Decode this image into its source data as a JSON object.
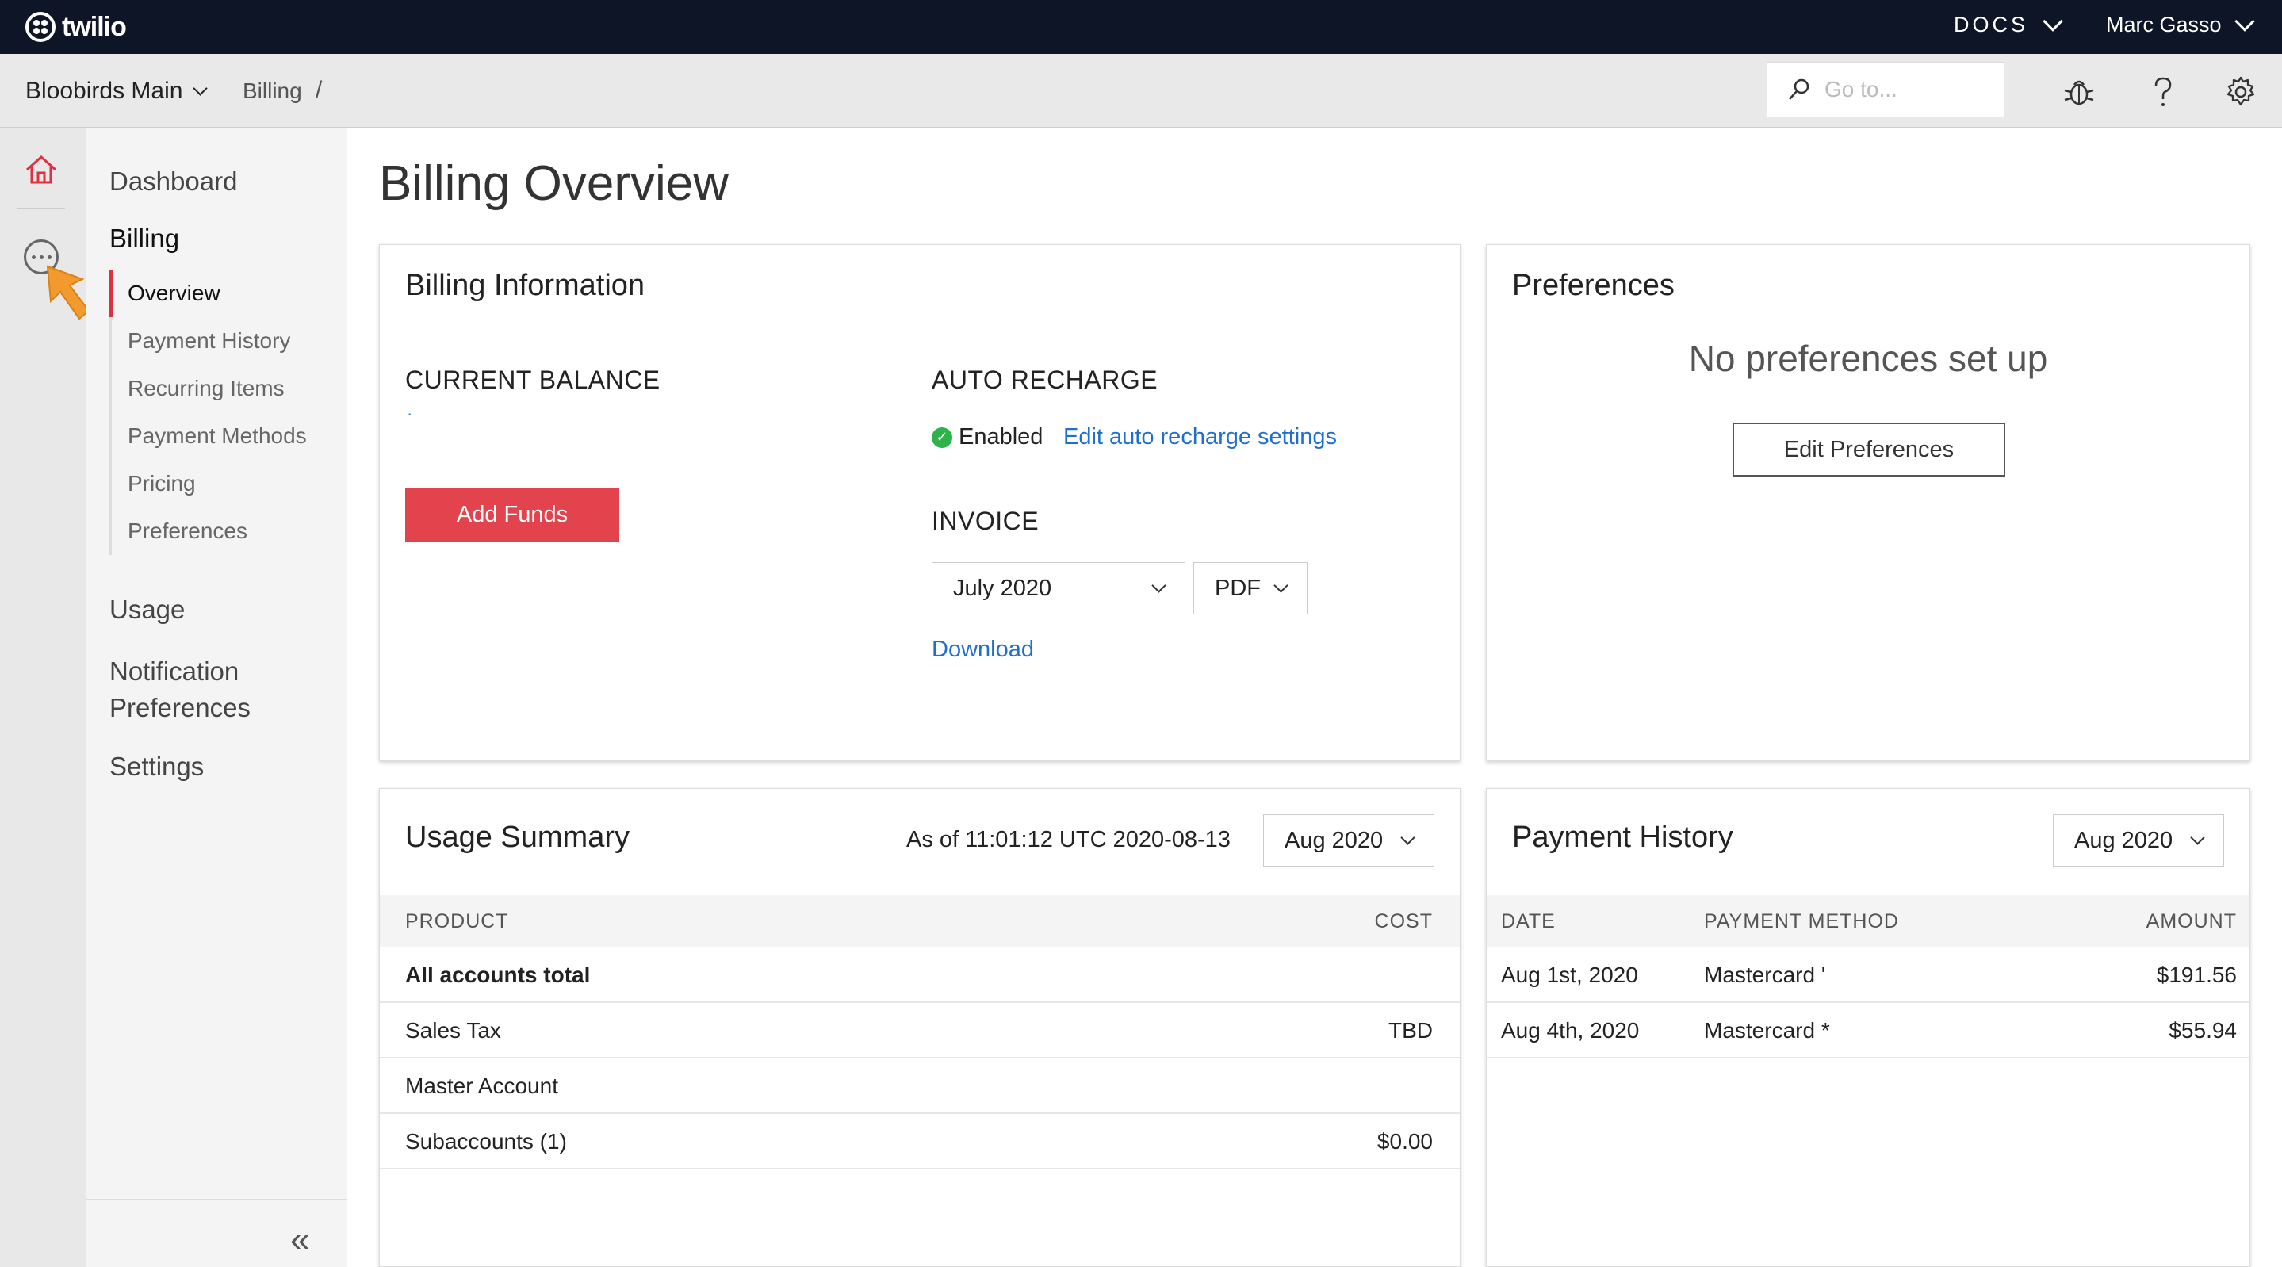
{
  "topbar": {
    "brand": "twilio",
    "docs_label": "DOCS",
    "user_name": "Marc Gasso"
  },
  "subbar": {
    "account_name": "Bloobirds Main",
    "breadcrumb": "Billing",
    "breadcrumb_separator": "/",
    "search_placeholder": "Go to..."
  },
  "sidebar": {
    "dashboard": "Dashboard",
    "billing": "Billing",
    "billing_items": [
      "Overview",
      "Payment History",
      "Recurring Items",
      "Payment Methods",
      "Pricing",
      "Preferences"
    ],
    "active_item": "Overview",
    "usage": "Usage",
    "notification_line1": "Notification",
    "notification_line2": "Preferences",
    "settings": "Settings",
    "collapse_glyph": "«"
  },
  "page": {
    "title": "Billing Overview"
  },
  "billing_info": {
    "title": "Billing Information",
    "current_balance_label": "CURRENT BALANCE",
    "current_balance_value": "·",
    "add_funds_label": "Add Funds",
    "auto_recharge_label": "AUTO RECHARGE",
    "auto_recharge_status": "Enabled",
    "edit_auto_recharge_link": "Edit auto recharge settings",
    "invoice_label": "INVOICE",
    "invoice_month": "July 2020",
    "invoice_format": "PDF",
    "download_link": "Download"
  },
  "preferences_card": {
    "title": "Preferences",
    "empty_message": "No preferences set up",
    "edit_button": "Edit Preferences"
  },
  "usage_summary": {
    "title": "Usage Summary",
    "as_of": "As of 11:01:12 UTC 2020-08-13",
    "period": "Aug 2020",
    "columns": [
      "PRODUCT",
      "COST"
    ],
    "rows": [
      {
        "product": "All accounts total",
        "cost": ""
      },
      {
        "product": "Sales Tax",
        "cost": "TBD"
      },
      {
        "product": "Master Account",
        "cost": ""
      },
      {
        "product": "Subaccounts (1)",
        "cost": "$0.00"
      }
    ]
  },
  "payment_history": {
    "title": "Payment History",
    "period": "Aug 2020",
    "columns": [
      "DATE",
      "PAYMENT METHOD",
      "AMOUNT"
    ],
    "rows": [
      {
        "date": "Aug 1st, 2020",
        "method": "Mastercard '",
        "amount": "$191.56"
      },
      {
        "date": "Aug 4th, 2020",
        "method": "Mastercard *",
        "amount": "$55.94"
      }
    ]
  },
  "colors": {
    "topbar_bg": "#0d1527",
    "accent_red": "#e2434d",
    "link_blue": "#1f6fd1",
    "status_green": "#2db34a",
    "cursor_orange": "#f29a2e"
  },
  "icons": [
    "twilio-logo-icon",
    "chevron-down-icon",
    "search-icon",
    "bug-icon",
    "help-icon",
    "gear-icon",
    "home-icon",
    "more-icon",
    "check-circle-icon",
    "collapse-icon"
  ]
}
